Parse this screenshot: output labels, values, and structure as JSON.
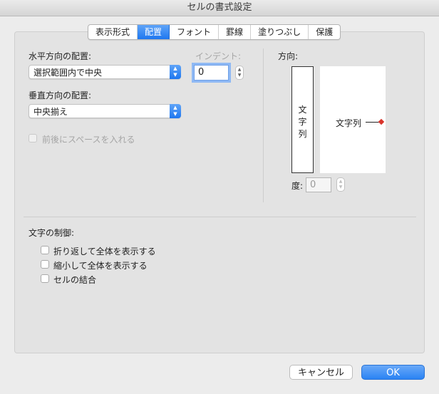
{
  "window": {
    "title": "セルの書式設定"
  },
  "tabs": [
    {
      "label": "表示形式",
      "active": false
    },
    {
      "label": "配置",
      "active": true
    },
    {
      "label": "フォント",
      "active": false
    },
    {
      "label": "罫線",
      "active": false
    },
    {
      "label": "塗りつぶし",
      "active": false
    },
    {
      "label": "保護",
      "active": false
    }
  ],
  "alignment": {
    "horizontal_label": "水平方向の配置:",
    "horizontal_value": "選択範囲内で中央",
    "indent_label": "インデント:",
    "indent_value": "0",
    "vertical_label": "垂直方向の配置:",
    "vertical_value": "中央揃え",
    "add_space_label": "前後にスペースを入れる"
  },
  "orientation": {
    "label": "方向:",
    "vertical_text": "文\n字\n列",
    "horizontal_text": "文字列",
    "degree_label": "度:",
    "degree_value": "0"
  },
  "text_control": {
    "label": "文字の制御:",
    "wrap_label": "折り返して全体を表示する",
    "shrink_label": "縮小して全体を表示する",
    "merge_label": "セルの結合"
  },
  "buttons": {
    "cancel": "キャンセル",
    "ok": "OK"
  },
  "colors": {
    "accent": "#1e77f0",
    "orientation_marker": "#d9342b"
  }
}
